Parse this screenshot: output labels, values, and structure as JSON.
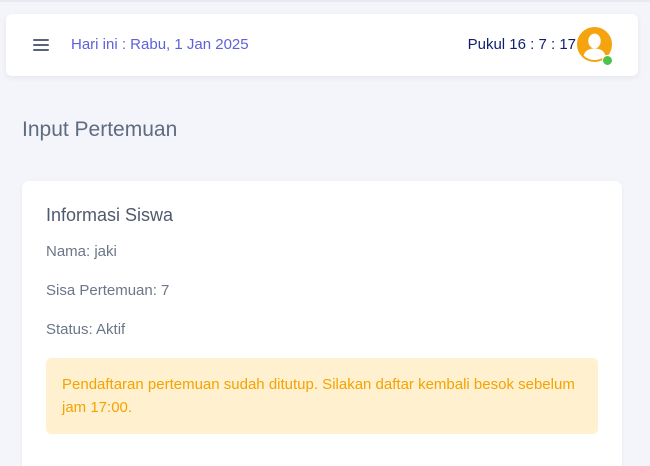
{
  "navbar": {
    "menu_icon": "hamburger-menu-icon",
    "date_text": "Hari ini : Rabu, 1 Jan 2025",
    "clock_text": "Pukul 16 : 7 : 17",
    "avatar_icon": "user-avatar-icon",
    "online_status": "online"
  },
  "page": {
    "title": "Input Pertemuan"
  },
  "student_card": {
    "title": "Informasi Siswa",
    "nama": "Nama: jaki",
    "sisa_pertemuan": "Sisa Pertemuan: 7",
    "status": "Status: Aktif",
    "alert_message": "Pendaftaran pertemuan sudah ditutup. Silakan daftar kembali besok sebelum jam 17:00."
  },
  "colors": {
    "background": "#f4f5fa",
    "date_text": "#5e62d8",
    "clock_text": "#0f1f6e",
    "avatar": "#f5a40f",
    "online_dot": "#4ec24a",
    "alert_bg": "#fff1cf",
    "alert_text": "#f4a300"
  }
}
